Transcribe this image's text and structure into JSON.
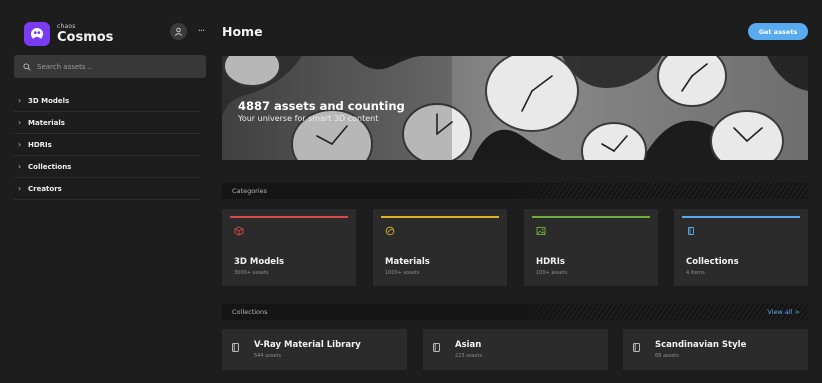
{
  "brand": {
    "small": "chaos",
    "name": "Cosmos",
    "accent": "#7a3cf0"
  },
  "header": {
    "more_glyph": "···"
  },
  "search": {
    "placeholder": "Search assets ..",
    "value": ""
  },
  "nav": {
    "items": [
      {
        "label": "3D Models"
      },
      {
        "label": "Materials"
      },
      {
        "label": "HDRIs"
      },
      {
        "label": "Collections"
      },
      {
        "label": "Creators"
      }
    ]
  },
  "main": {
    "title": "Home",
    "get_assets_label": "Get assets",
    "accent": "#5aaaf0"
  },
  "hero": {
    "title": "4887 assets and counting",
    "subtitle": "Your universe for smart 3D content"
  },
  "categories": {
    "label": "Categories",
    "items": [
      {
        "name": "3D Models",
        "count": "3000+ assets",
        "color": "#d64a4a",
        "icon": "cube-icon"
      },
      {
        "name": "Materials",
        "count": "1000+ assets",
        "color": "#e0b22a",
        "icon": "material-sphere-icon"
      },
      {
        "name": "HDRIs",
        "count": "100+ assets",
        "color": "#6fae3a",
        "icon": "image-icon"
      },
      {
        "name": "Collections",
        "count": "4 items",
        "color": "#5aaaf0",
        "icon": "collection-icon"
      }
    ]
  },
  "collections": {
    "label": "Collections",
    "view_all": "View all >",
    "items": [
      {
        "name": "V-Ray Material Library",
        "count": "544 assets"
      },
      {
        "name": "Asian",
        "count": "223 assets"
      },
      {
        "name": "Scandinavian Style",
        "count": "68 assets"
      }
    ]
  }
}
